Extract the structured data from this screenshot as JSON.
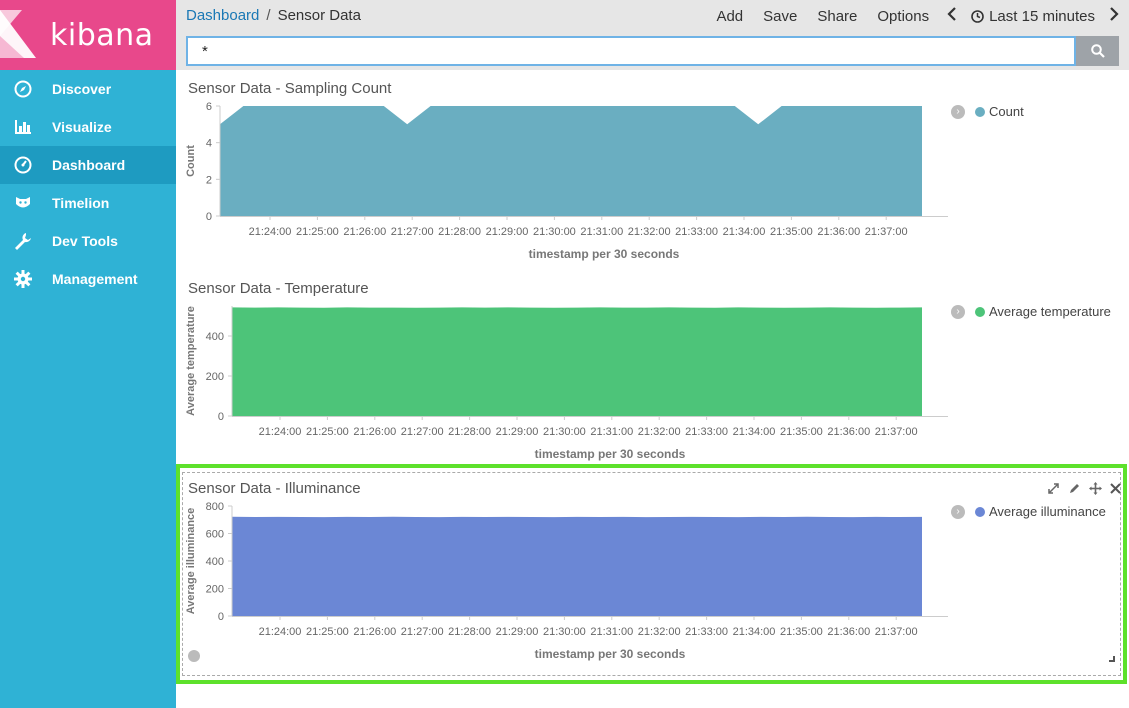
{
  "app": {
    "name": "kibana",
    "brand_color": "#e8488b",
    "sidebar_color": "#2fb2d5",
    "active_color": "#1e9bc1"
  },
  "sidebar": {
    "items": [
      {
        "label": "Discover",
        "icon": "compass-icon"
      },
      {
        "label": "Visualize",
        "icon": "bar-chart-icon"
      },
      {
        "label": "Dashboard",
        "icon": "gauge-icon",
        "active": true
      },
      {
        "label": "Timelion",
        "icon": "timelion-icon"
      },
      {
        "label": "Dev Tools",
        "icon": "wrench-icon"
      },
      {
        "label": "Management",
        "icon": "gear-icon"
      }
    ]
  },
  "header": {
    "breadcrumb": {
      "parent": "Dashboard",
      "separator": "/",
      "current": "Sensor Data"
    },
    "actions": {
      "add": "Add",
      "save": "Save",
      "share": "Share",
      "options": "Options"
    },
    "time_range": "Last 15 minutes"
  },
  "search": {
    "value": "*"
  },
  "panels": [
    {
      "title": "Sensor Data - Sampling Count",
      "legend": "Count",
      "ylabel": "Count",
      "xlabel": "timestamp per 30 seconds",
      "color": "#6aaec1"
    },
    {
      "title": "Sensor Data - Temperature",
      "legend": "Average temperature",
      "ylabel": "Average temperature",
      "xlabel": "timestamp per 30 seconds",
      "color": "#4dc479"
    },
    {
      "title": "Sensor Data - Illuminance",
      "legend": "Average illuminance",
      "ylabel": "Average illuminance",
      "xlabel": "timestamp per 30 seconds",
      "color": "#6b87d5"
    }
  ],
  "chart_data": [
    {
      "type": "area",
      "title": "Sensor Data - Sampling Count",
      "xlabel": "timestamp per 30 seconds",
      "ylabel": "Count",
      "ylim": [
        0,
        6
      ],
      "yticks": [
        "0",
        "2",
        "4",
        "6"
      ],
      "xticks": [
        "21:24:00",
        "21:25:00",
        "21:26:00",
        "21:27:00",
        "21:28:00",
        "21:29:00",
        "21:30:00",
        "21:31:00",
        "21:32:00",
        "21:33:00",
        "21:34:00",
        "21:35:00",
        "21:36:00",
        "21:37:00"
      ],
      "series": [
        {
          "name": "Count",
          "x": [
            "21:22:30",
            "21:23:00",
            "21:23:30",
            "21:24:00",
            "21:24:30",
            "21:25:00",
            "21:25:30",
            "21:26:00",
            "21:26:30",
            "21:27:00",
            "21:27:30",
            "21:28:00",
            "21:28:30",
            "21:29:00",
            "21:29:30",
            "21:30:00",
            "21:30:30",
            "21:31:00",
            "21:31:30",
            "21:32:00",
            "21:32:30",
            "21:33:00",
            "21:33:30",
            "21:34:00",
            "21:34:30",
            "21:35:00",
            "21:35:30",
            "21:36:00",
            "21:36:30",
            "21:37:00",
            "21:37:30"
          ],
          "values": [
            5,
            6,
            6,
            6,
            6,
            6,
            6,
            6,
            5,
            6,
            6,
            6,
            6,
            6,
            6,
            6,
            6,
            6,
            6,
            6,
            6,
            6,
            6,
            5,
            6,
            6,
            6,
            6,
            6,
            6,
            6
          ]
        }
      ]
    },
    {
      "type": "area",
      "title": "Sensor Data - Temperature",
      "xlabel": "timestamp per 30 seconds",
      "ylabel": "Average temperature",
      "ylim": [
        0,
        550
      ],
      "yticks": [
        "0",
        "200",
        "400"
      ],
      "xticks": [
        "21:24:00",
        "21:25:00",
        "21:26:00",
        "21:27:00",
        "21:28:00",
        "21:29:00",
        "21:30:00",
        "21:31:00",
        "21:32:00",
        "21:33:00",
        "21:34:00",
        "21:35:00",
        "21:36:00",
        "21:37:00"
      ],
      "series": [
        {
          "name": "Average temperature",
          "values": [
            543,
            542,
            543,
            542,
            541,
            543,
            542,
            542,
            541,
            542,
            543,
            542,
            543,
            542,
            541,
            542,
            543,
            542,
            542,
            543,
            542,
            541,
            543,
            542,
            541,
            542,
            543,
            542,
            541,
            542,
            543
          ]
        }
      ]
    },
    {
      "type": "area",
      "title": "Sensor Data - Illuminance",
      "xlabel": "timestamp per 30 seconds",
      "ylabel": "Average illuminance",
      "ylim": [
        0,
        800
      ],
      "yticks": [
        "0",
        "200",
        "400",
        "600",
        "800"
      ],
      "xticks": [
        "21:24:00",
        "21:25:00",
        "21:26:00",
        "21:27:00",
        "21:28:00",
        "21:29:00",
        "21:30:00",
        "21:31:00",
        "21:32:00",
        "21:33:00",
        "21:34:00",
        "21:35:00",
        "21:36:00",
        "21:37:00"
      ],
      "series": [
        {
          "name": "Average illuminance",
          "values": [
            722,
            720,
            721,
            720,
            719,
            721,
            720,
            722,
            720,
            719,
            721,
            720,
            721,
            720,
            719,
            721,
            720,
            721,
            719,
            720,
            721,
            720,
            719,
            721,
            720,
            722,
            720,
            719,
            721,
            720,
            721
          ]
        }
      ]
    }
  ]
}
